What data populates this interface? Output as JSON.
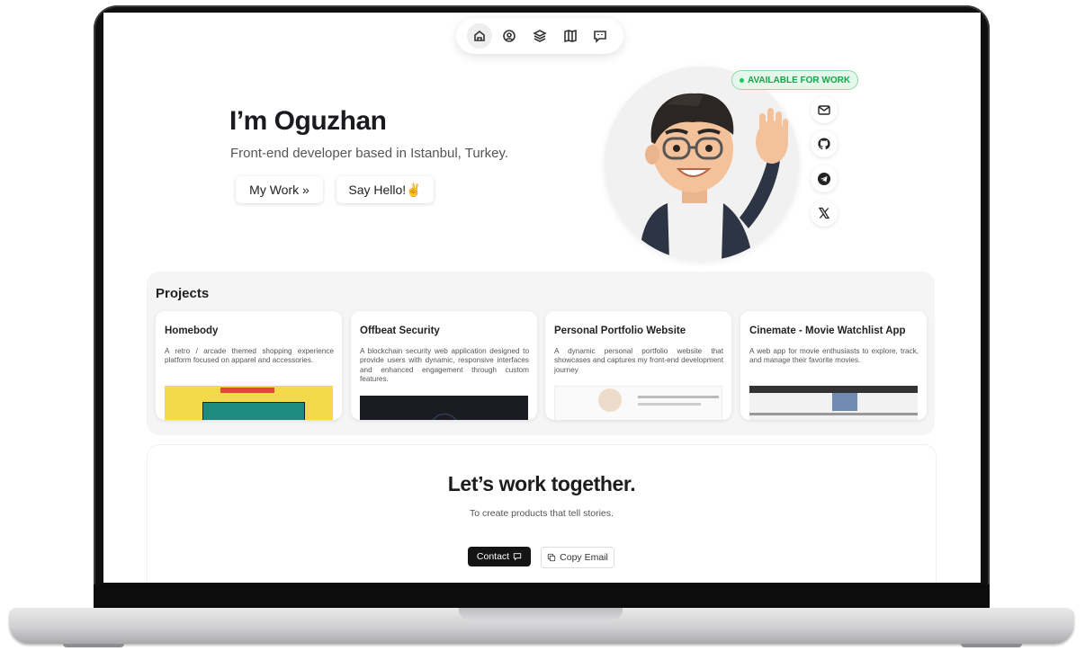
{
  "nav": {
    "items": [
      {
        "icon": "home-icon",
        "active": true
      },
      {
        "icon": "user-icon"
      },
      {
        "icon": "layers-icon"
      },
      {
        "icon": "map-icon"
      },
      {
        "icon": "message-icon"
      }
    ]
  },
  "hero": {
    "name": "I’m Oguzhan",
    "subtitle": "Front-end developer based in Istanbul, Turkey.",
    "my_work_label": "My Work »",
    "say_hello_label": "Say Hello!✌️",
    "badge": "AVAILABLE FOR WORK",
    "socials": [
      "mail-icon",
      "github-icon",
      "telegram-icon",
      "x-icon"
    ]
  },
  "projects": {
    "title": "Projects",
    "items": [
      {
        "title": "Homebody",
        "description": "A retro / arcade themed shopping experience platform focused on apparel and accessories."
      },
      {
        "title": "Offbeat Security",
        "description": "A blockchain security web application designed to provide users with dynamic, responsive interfaces and enhanced engagement through custom features."
      },
      {
        "title": "Personal Portfolio Website",
        "description": "A dynamic personal portfolio website that showcases and captures my front-end development journey"
      },
      {
        "title": "Cinemate - Movie Watchlist App",
        "description": "A web app for movie enthusiasts to explore, track, and manage their favorite movies."
      }
    ]
  },
  "cta": {
    "title": "Let’s work together.",
    "subtitle": "To create products that tell stories.",
    "contact_label": "Contact",
    "copy_label": "Copy Email"
  },
  "colors": {
    "badge_green": "#17a44a",
    "dark_button": "#141414",
    "project_bg": "#f5f5f6"
  }
}
